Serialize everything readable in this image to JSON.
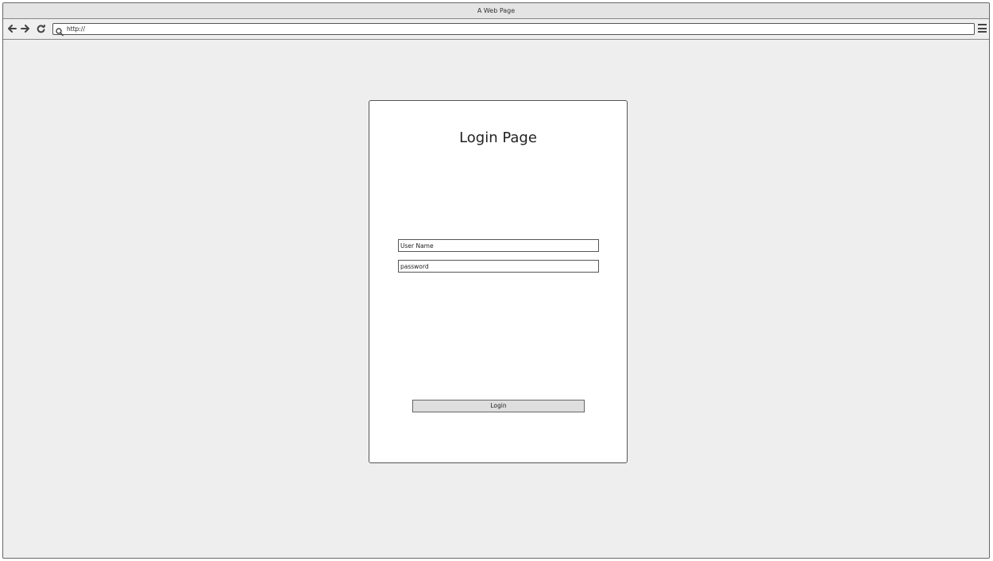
{
  "window": {
    "title": "A Web Page"
  },
  "toolbar": {
    "back_icon": "arrow-left-icon",
    "forward_icon": "arrow-right-icon",
    "reload_icon": "reload-icon",
    "search_icon": "search-icon",
    "menu_icon": "hamburger-menu-icon",
    "url": "http://"
  },
  "login": {
    "title": "Login Page",
    "username_placeholder": "User Name",
    "password_placeholder": "password",
    "submit_label": "Login"
  }
}
